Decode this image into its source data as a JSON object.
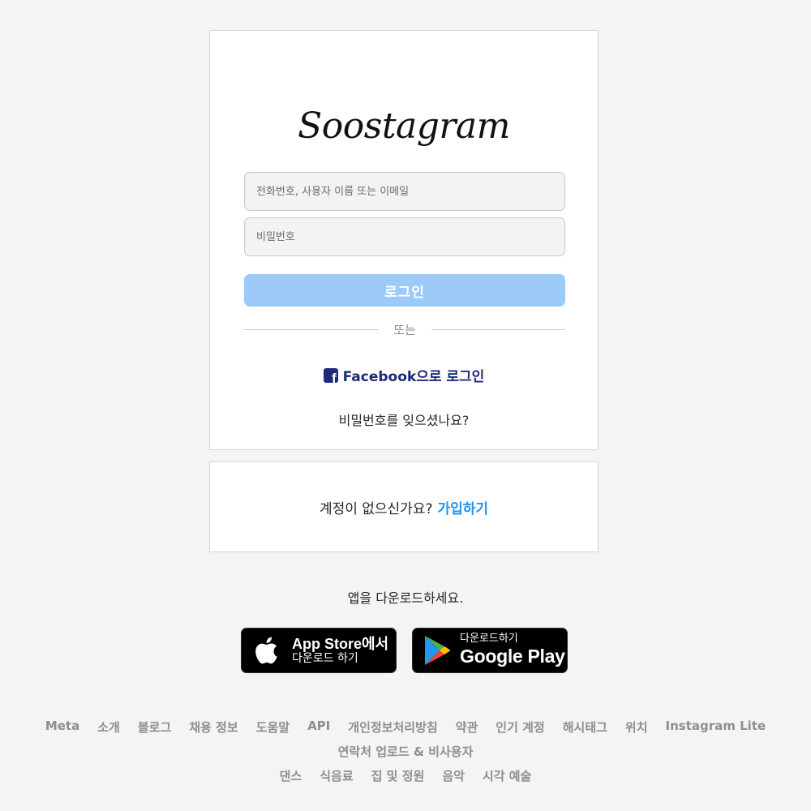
{
  "logo": "Soostagram",
  "login": {
    "username_placeholder": "전화번호, 사용자 이름 또는 이메일",
    "password_placeholder": "비밀번호",
    "login_button": "로그인",
    "divider": "또는",
    "facebook_icon": "facebook-icon",
    "facebook_label": "Facebook으로 로그인",
    "forgot_password": "비밀번호를 잊으셨나요?"
  },
  "signup": {
    "prompt": "계정이 없으신가요?",
    "link": "가입하기"
  },
  "download": {
    "text": "앱을 다운로드하세요.",
    "app_store_line1": "App Store에서",
    "app_store_line2": "다운로드 하기",
    "google_play_line1": "다운로드하기",
    "google_play_line2": "Google Play"
  },
  "footer": {
    "row1": [
      "Meta",
      "소개",
      "블로그",
      "채용 정보",
      "도움말",
      "API",
      "개인정보처리방침",
      "약관",
      "인기 계정",
      "해시태그",
      "위치",
      "Instagram Lite"
    ],
    "row2": [
      "연락처 업로드 & 비사용자"
    ],
    "row3": [
      "댄스",
      "식음료",
      "집 및 정원",
      "음악",
      "시각 예술"
    ]
  },
  "colors": {
    "background": "#f4f4f4",
    "login_button": "#9ccbf9",
    "facebook_blue": "#1d2a7a",
    "link_blue": "#1f95f1"
  }
}
